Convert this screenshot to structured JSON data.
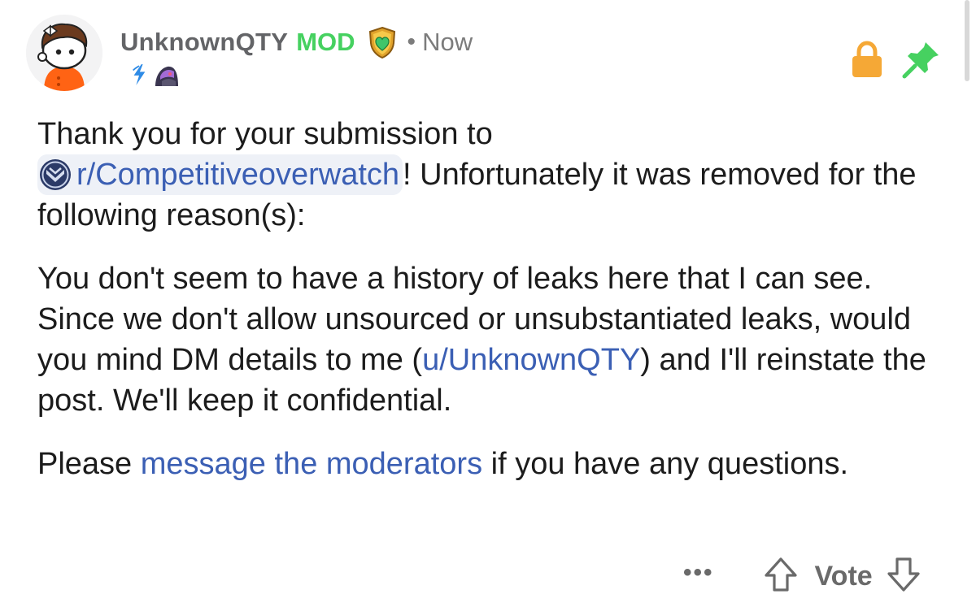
{
  "comment": {
    "author": "UnknownQTY",
    "mod_badge": "MOD",
    "separator": "•",
    "timestamp": "Now",
    "icons": {
      "avatar": "snoo-avatar",
      "mod_shield": "green-heart-shield-icon",
      "flair_1": "blue-lightning-icon",
      "flair_2": "hero-portrait-icon",
      "lock": "lock-icon",
      "pin": "pin-icon"
    },
    "colors": {
      "mod_green": "#46d160",
      "link_blue": "#3b5fb4",
      "lock_orange": "#f5a836",
      "pin_green": "#46d160",
      "username_gray": "#636467"
    },
    "body": {
      "p1_before": "Thank you for your submission to",
      "subreddit_link": "r/Competitiveoverwatch",
      "p1_after": "! Unfortunately it was removed for the following reason(s):",
      "p2_before": "You don't seem to have a history of leaks here that I can see. Since we don't allow unsourced or unsubstantiated leaks, would you mind DM details to me (",
      "user_link": "u/UnknownQTY",
      "p2_after": ") and I'll reinstate the post. We'll keep it confidential.",
      "p3_before": "Please ",
      "mod_link": "message the moderators",
      "p3_after": " if you have any questions."
    },
    "footer": {
      "more": "•••",
      "vote_label": "Vote"
    }
  }
}
